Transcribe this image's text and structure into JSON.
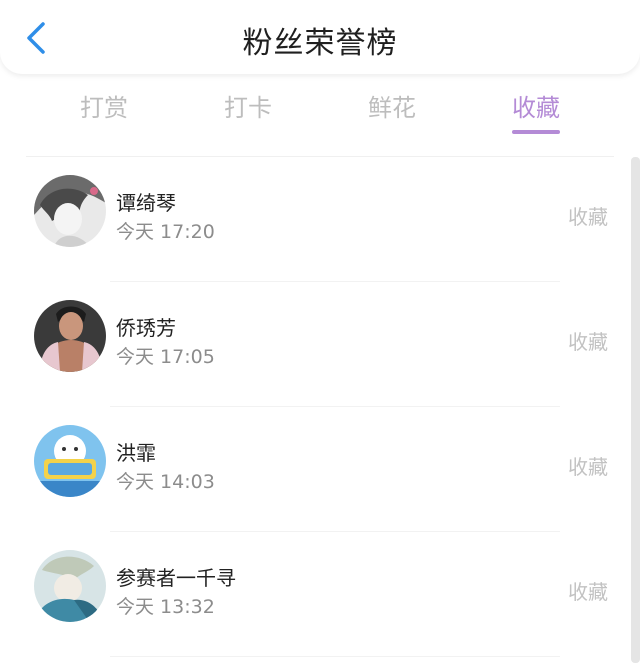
{
  "header": {
    "title": "粉丝荣誉榜",
    "back_icon": "chevron-left-icon",
    "accent": "#2f8ee8"
  },
  "tabs": [
    {
      "label": "打赏",
      "active": false
    },
    {
      "label": "打卡",
      "active": false
    },
    {
      "label": "鲜花",
      "active": false
    },
    {
      "label": "收藏",
      "active": true
    }
  ],
  "colors": {
    "active_tab": "#b48bd6",
    "inactive_tab": "#bdbdbd"
  },
  "list": [
    {
      "name": "谭绮琴",
      "time": "今天 17:20",
      "action": "收藏"
    },
    {
      "name": "侨琇芳",
      "time": "今天 17:05",
      "action": "收藏"
    },
    {
      "name": "洪霏",
      "time": "今天 14:03",
      "action": "收藏"
    },
    {
      "name": "参赛者一千寻",
      "time": "今天 13:32",
      "action": "收藏"
    }
  ]
}
